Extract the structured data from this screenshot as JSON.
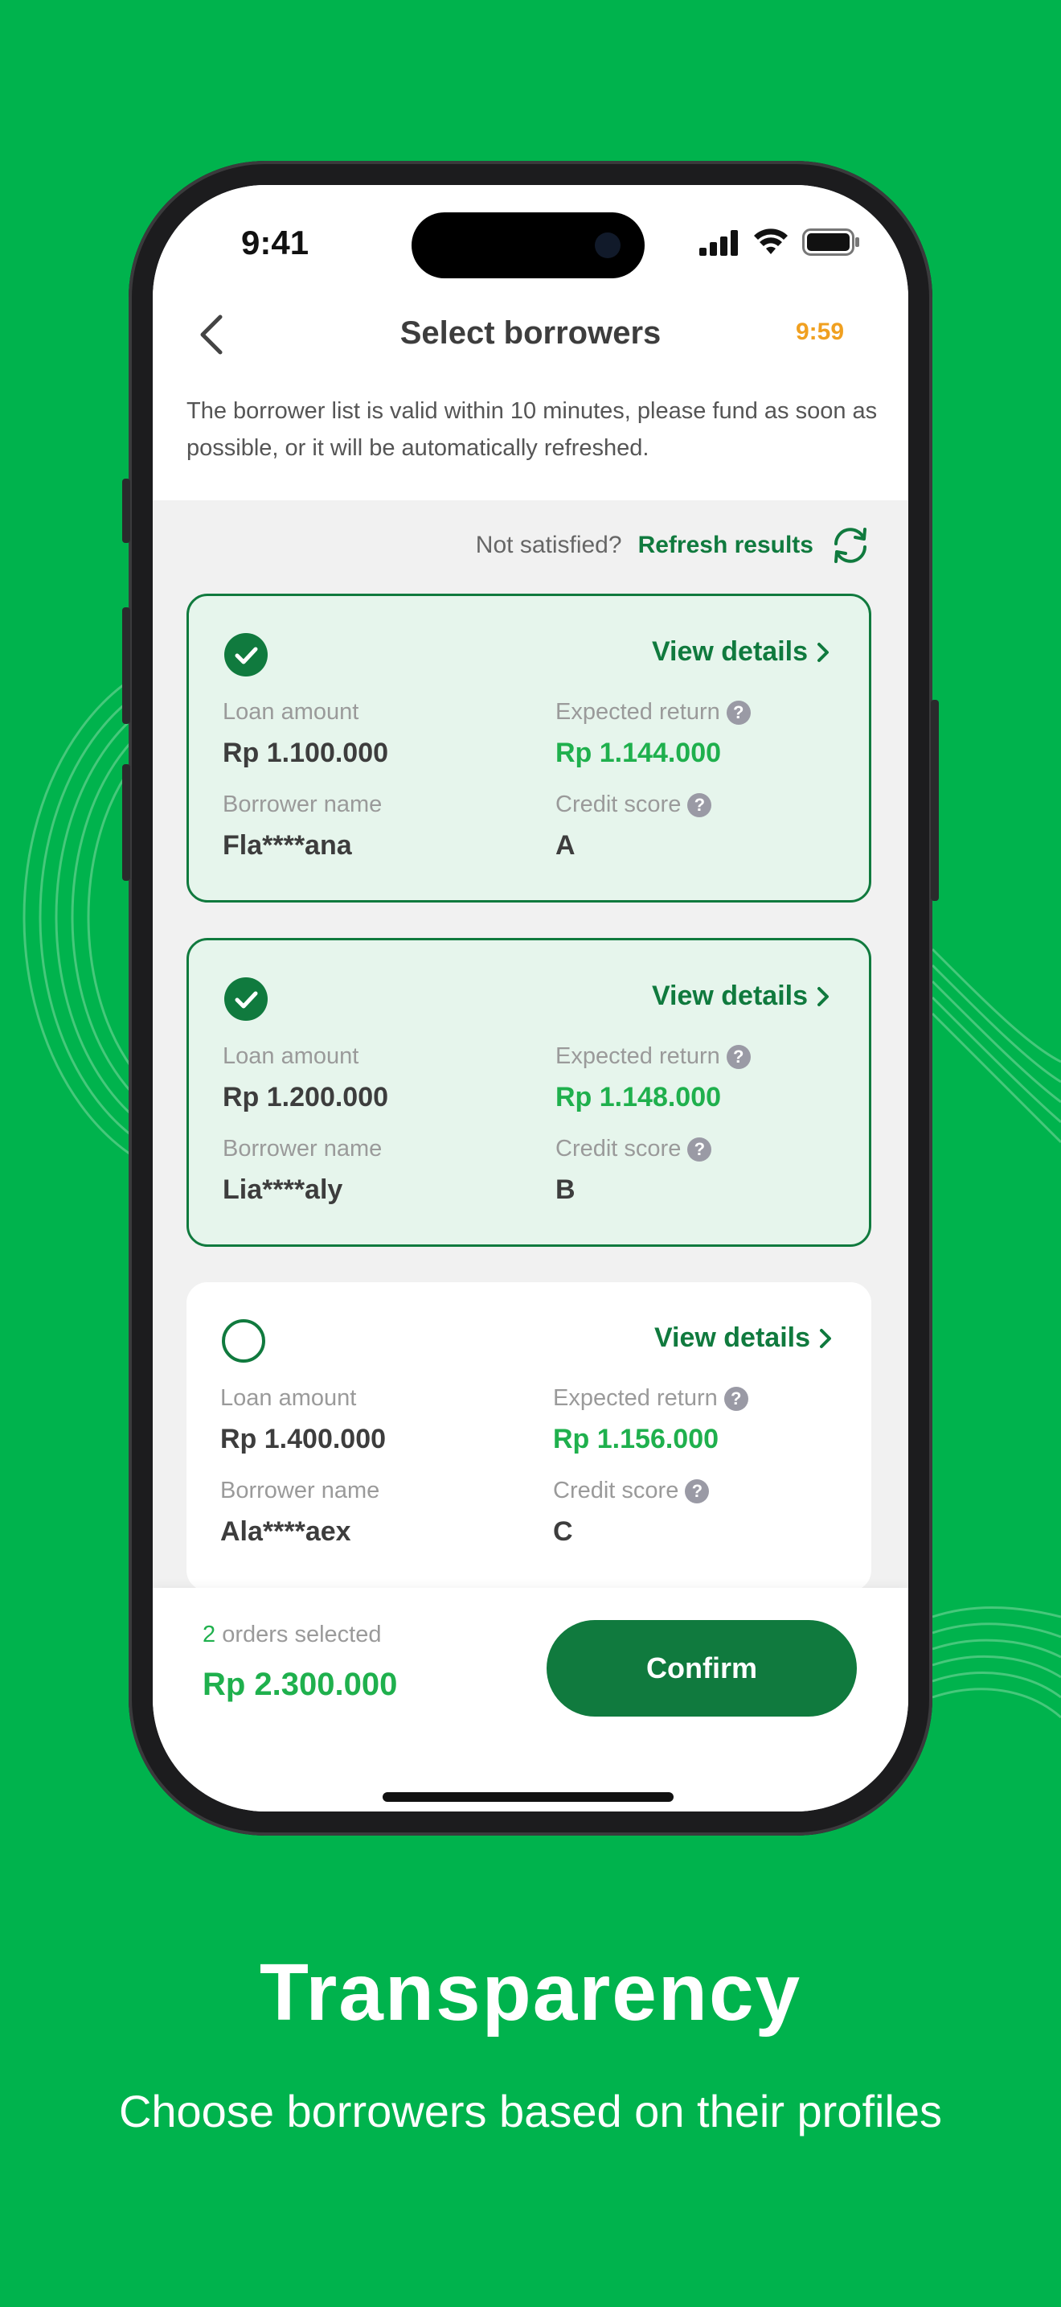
{
  "status_bar": {
    "time": "9:41"
  },
  "header": {
    "title": "Select borrowers",
    "timer": "9:59",
    "notice": "The borrower list is valid within 10 minutes, please fund as soon as possible, or it will be automatically refreshed."
  },
  "refresh": {
    "question": "Not satisfied?",
    "link": "Refresh results"
  },
  "labels": {
    "loan_amount": "Loan amount",
    "expected_return": "Expected return",
    "borrower_name": "Borrower name",
    "credit_score": "Credit score",
    "view_details": "View details"
  },
  "borrowers": [
    {
      "selected": true,
      "loan_amount": "Rp 1.100.000",
      "expected_return": "Rp 1.144.000",
      "borrower_name": "Fla****ana",
      "credit_score": "A"
    },
    {
      "selected": true,
      "loan_amount": "Rp 1.200.000",
      "expected_return": "Rp 1.148.000",
      "borrower_name": "Lia****aly",
      "credit_score": "B"
    },
    {
      "selected": false,
      "loan_amount": "Rp 1.400.000",
      "expected_return": "Rp 1.156.000",
      "borrower_name": "Ala****aex",
      "credit_score": "C"
    }
  ],
  "footer": {
    "selected_count": "2",
    "selected_text": "orders selected",
    "total": "Rp 2.300.000",
    "confirm_label": "Confirm"
  },
  "promo": {
    "headline": "Transparency",
    "subline": "Choose borrowers based on their profiles"
  },
  "colors": {
    "background": "#00b34d",
    "primary": "#107a3e",
    "accent_green": "#1fb04d",
    "timer": "#f0a020"
  }
}
